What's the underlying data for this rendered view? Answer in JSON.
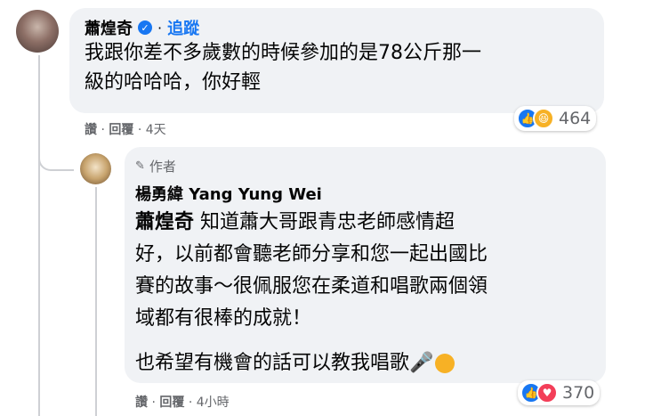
{
  "comment": {
    "author": "蕭煌奇",
    "follow_label": "追蹤",
    "text_lines": [
      "我跟你差不多歲數的時候參加的是78公斤那一",
      "級的哈哈哈，你好輕"
    ],
    "meta": {
      "like": "讚",
      "reply": "回覆",
      "time": "4天"
    },
    "reactions": {
      "count": "464",
      "types": [
        "like-icon",
        "haha-icon"
      ]
    }
  },
  "reply": {
    "badge": "作者",
    "author": "楊勇緯 Yang Yung Wei",
    "mention": "蕭煌奇",
    "first_line_rest": "知道蕭大哥跟青忠老師感情超",
    "lines": [
      "好，以前都會聽老師分享和您一起出國比",
      "賽的故事～很佩服您在柔道和唱歌兩個領",
      "域都有很棒的成就！"
    ],
    "last_line": "也希望有機會的話可以教我唱歌",
    "meta": {
      "like": "讚",
      "reply": "回覆",
      "time": "4小時"
    },
    "reactions": {
      "count": "370",
      "types": [
        "like-icon",
        "love-icon"
      ]
    }
  },
  "colors": {
    "accent": "#1877f2",
    "bubble": "#f0f2f5",
    "meta": "#65676b"
  }
}
